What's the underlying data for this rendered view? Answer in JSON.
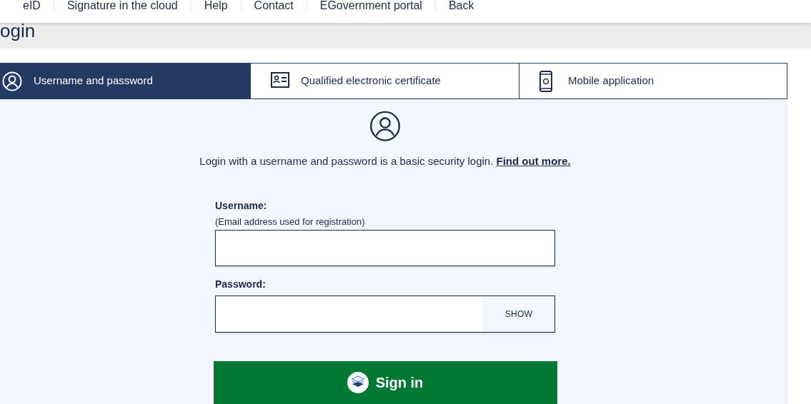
{
  "nav": {
    "items": [
      "eID",
      "Signature in the cloud",
      "Help",
      "Contact",
      "EGovernment portal",
      "Back"
    ]
  },
  "page_title": "ogin",
  "tabs": [
    {
      "label": "Username and password",
      "kind": "user",
      "selected": true
    },
    {
      "label": "Qualified electronic certificate",
      "kind": "card",
      "selected": false
    },
    {
      "label": "Mobile application",
      "kind": "phone",
      "selected": false
    }
  ],
  "intro": {
    "text": "Login with a username and password is a basic security login.",
    "link": "Find out more."
  },
  "username": {
    "label": "Username:",
    "hint": "(Email address used for registration)"
  },
  "password": {
    "label": "Password:",
    "toggle": "SHOW"
  },
  "sign_in": "Sign in"
}
